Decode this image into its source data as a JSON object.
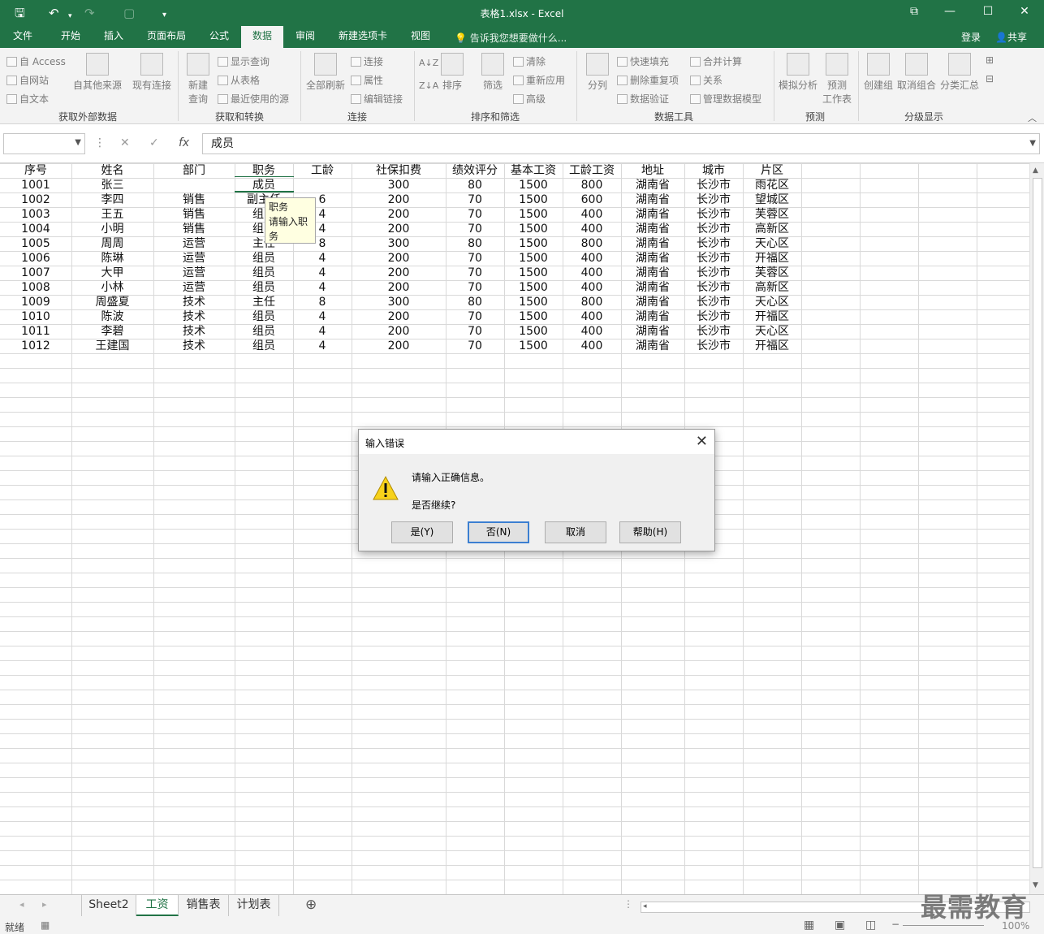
{
  "window": {
    "title": "表格1.xlsx - Excel"
  },
  "tabs": [
    {
      "label": "文件",
      "active": false
    },
    {
      "label": "开始",
      "active": false
    },
    {
      "label": "插入",
      "active": false
    },
    {
      "label": "页面布局",
      "active": false
    },
    {
      "label": "公式",
      "active": false
    },
    {
      "label": "数据",
      "active": true
    },
    {
      "label": "审阅",
      "active": false
    },
    {
      "label": "新建选项卡",
      "active": false
    },
    {
      "label": "视图",
      "active": false
    }
  ],
  "tellme": "告诉我您想要做什么...",
  "account": {
    "login": "登录",
    "share": "共享"
  },
  "ribbon": {
    "get_external": {
      "access": "自 Access",
      "web": "自网站",
      "text": "自文本",
      "other": "自其他来源",
      "existing": "现有连接",
      "group": "获取外部数据"
    },
    "get_transform": {
      "new_query_1": "新建",
      "new_query_2": "查询",
      "show_queries": "显示查询",
      "from_table": "从表格",
      "recent_sources": "最近使用的源",
      "group": "获取和转换"
    },
    "connections": {
      "refresh_all": "全部刷新",
      "connections": "连接",
      "properties": "属性",
      "edit_links": "编辑链接",
      "group": "连接"
    },
    "sort_filter": {
      "sort": "排序",
      "filter": "筛选",
      "clear": "清除",
      "reapply": "重新应用",
      "advanced": "高级",
      "group": "排序和筛选"
    },
    "data_tools": {
      "text_to_cols": "分列",
      "flash_fill": "快速填充",
      "remove_dup": "删除重复项",
      "validation": "数据验证",
      "consolidate": "合并计算",
      "relationships": "关系",
      "manage_model": "管理数据模型",
      "group": "数据工具"
    },
    "forecast": {
      "what_if": "模拟分析",
      "forecast_1": "预测",
      "forecast_2": "工作表",
      "group": "预测"
    },
    "outline": {
      "group_btn": "创建组",
      "ungroup": "取消组合",
      "subtotal": "分类汇总",
      "group": "分级显示"
    }
  },
  "formula_bar": {
    "fx": "fx",
    "value": "成员"
  },
  "sheet": {
    "headers": [
      "序号",
      "姓名",
      "部门",
      "职务",
      "工龄",
      "社保扣费",
      "绩效评分",
      "基本工资",
      "工龄工资",
      "地址",
      "城市",
      "片区"
    ],
    "rows": [
      [
        "1001",
        "张三",
        "",
        "成员",
        "",
        "300",
        "80",
        "1500",
        "800",
        "湖南省",
        "长沙市",
        "雨花区"
      ],
      [
        "1002",
        "李四",
        "销售",
        "副主任",
        "6",
        "200",
        "70",
        "1500",
        "600",
        "湖南省",
        "长沙市",
        "望城区"
      ],
      [
        "1003",
        "王五",
        "销售",
        "组员",
        "4",
        "200",
        "70",
        "1500",
        "400",
        "湖南省",
        "长沙市",
        "芙蓉区"
      ],
      [
        "1004",
        "小明",
        "销售",
        "组员",
        "4",
        "200",
        "70",
        "1500",
        "400",
        "湖南省",
        "长沙市",
        "高新区"
      ],
      [
        "1005",
        "周周",
        "运营",
        "主任",
        "8",
        "300",
        "80",
        "1500",
        "800",
        "湖南省",
        "长沙市",
        "天心区"
      ],
      [
        "1006",
        "陈琳",
        "运营",
        "组员",
        "4",
        "200",
        "70",
        "1500",
        "400",
        "湖南省",
        "长沙市",
        "开福区"
      ],
      [
        "1007",
        "大甲",
        "运营",
        "组员",
        "4",
        "200",
        "70",
        "1500",
        "400",
        "湖南省",
        "长沙市",
        "芙蓉区"
      ],
      [
        "1008",
        "小林",
        "运营",
        "组员",
        "4",
        "200",
        "70",
        "1500",
        "400",
        "湖南省",
        "长沙市",
        "高新区"
      ],
      [
        "1009",
        "周盛夏",
        "技术",
        "主任",
        "8",
        "300",
        "80",
        "1500",
        "800",
        "湖南省",
        "长沙市",
        "天心区"
      ],
      [
        "1010",
        "陈波",
        "技术",
        "组员",
        "4",
        "200",
        "70",
        "1500",
        "400",
        "湖南省",
        "长沙市",
        "开福区"
      ],
      [
        "1011",
        "李碧",
        "技术",
        "组员",
        "4",
        "200",
        "70",
        "1500",
        "400",
        "湖南省",
        "长沙市",
        "天心区"
      ],
      [
        "1012",
        "王建国",
        "技术",
        "组员",
        "4",
        "200",
        "70",
        "1500",
        "400",
        "湖南省",
        "长沙市",
        "开福区"
      ]
    ]
  },
  "tooltip": {
    "title": "职务",
    "body": "请输入职务"
  },
  "dialog": {
    "title": "输入错误",
    "message": "请输入正确信息。",
    "question": "是否继续?",
    "buttons": {
      "yes": "是(Y)",
      "no": "否(N)",
      "cancel": "取消",
      "help": "帮助(H)"
    }
  },
  "sheet_tabs": [
    {
      "label": "Sheet2",
      "active": false
    },
    {
      "label": "工资",
      "active": true
    },
    {
      "label": "销售表",
      "active": false
    },
    {
      "label": "计划表",
      "active": false
    }
  ],
  "status": {
    "ready": "就绪",
    "zoom": "100%"
  },
  "watermark": "最需教育",
  "colors": {
    "excel_green": "#217346",
    "tooltip_bg": "#ffffe1",
    "focus_blue": "#3c7fd1"
  }
}
